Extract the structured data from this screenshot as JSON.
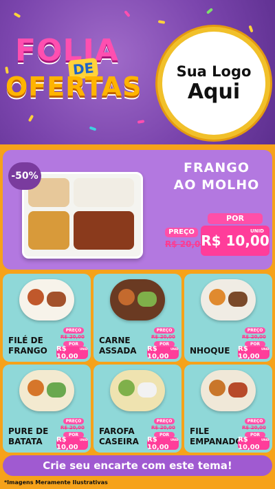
{
  "header": {
    "logo_word1": "FOLIA",
    "logo_word2": "DE",
    "logo_word3": "OFERTAS",
    "store_logo_line1": "Sua Logo",
    "store_logo_line2": "Aqui"
  },
  "featured": {
    "discount_badge": "-50%",
    "name_line1": "FRANGO",
    "name_line2": "AO MOLHO",
    "old_label": "PREÇO",
    "old_price": "R$ 20,00",
    "new_label": "POR",
    "new_price": "R$ 10,00",
    "unit": "UNID"
  },
  "products": [
    {
      "name_line1": "FILÉ DE",
      "name_line2": "FRANGO",
      "old_label": "PREÇO",
      "old_price": "R$ 20,00",
      "new_label": "POR",
      "new_price": "R$ 10,00",
      "unit": "UNID"
    },
    {
      "name_line1": "CARNE",
      "name_line2": "ASSADA",
      "old_label": "PREÇO",
      "old_price": "R$ 20,00",
      "new_label": "POR",
      "new_price": "R$ 10,00",
      "unit": "UNID"
    },
    {
      "name_line1": "NHOQUE",
      "name_line2": "",
      "old_label": "PREÇO",
      "old_price": "R$ 20,00",
      "new_label": "POR",
      "new_price": "R$ 10,00",
      "unit": "UNID"
    },
    {
      "name_line1": "PURE DE",
      "name_line2": "BATATA",
      "old_label": "PREÇO",
      "old_price": "R$ 20,00",
      "new_label": "POR",
      "new_price": "R$ 10,00",
      "unit": "UNID"
    },
    {
      "name_line1": "FAROFA",
      "name_line2": "CASEIRA",
      "old_label": "PREÇO",
      "old_price": "R$ 20,00",
      "new_label": "POR",
      "new_price": "R$ 10,00",
      "unit": "UNID"
    },
    {
      "name_line1": "FILE",
      "name_line2": "EMPANADO",
      "old_label": "PREÇO",
      "old_price": "R$ 20,00",
      "new_label": "POR",
      "new_price": "R$ 10,00",
      "unit": "UNID"
    }
  ],
  "cta": "Crie seu encarte com este tema!",
  "footnote": "*Imagens Meramente Ilustrativas",
  "colors": {
    "header_bg": "#7b45ad",
    "page_bg": "#f6a21a",
    "featured_bg": "#b378e0",
    "card_bg": "#8fd8d8",
    "price_pink": "#ff3d9a",
    "cta_bg": "#a05ad1"
  }
}
